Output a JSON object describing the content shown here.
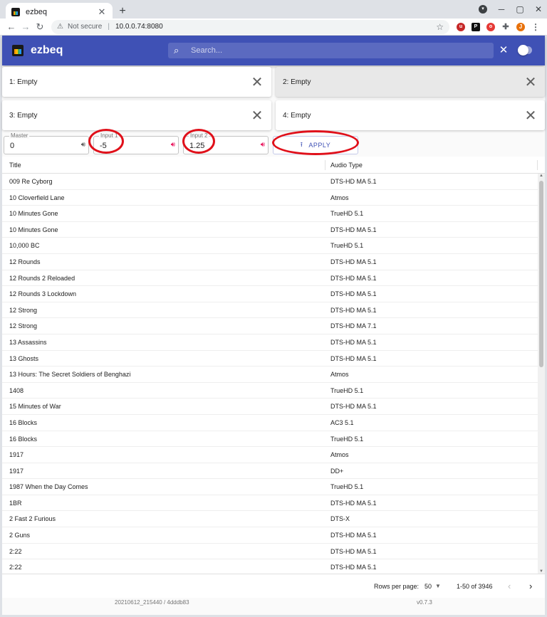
{
  "browser": {
    "tab_title": "ezbeq",
    "tab_close": "✕",
    "new_tab": "+",
    "security_label": "Not secure",
    "url": "10.0.0.74:8080",
    "profile_initial": "J"
  },
  "app": {
    "title": "ezbeq",
    "search": {
      "placeholder": "Search..."
    },
    "clear": "✕"
  },
  "slots": [
    {
      "label": "1: Empty",
      "active": false
    },
    {
      "label": "2: Empty",
      "active": true
    },
    {
      "label": "3: Empty",
      "active": false
    },
    {
      "label": "4: Empty",
      "active": false
    }
  ],
  "controls": {
    "master": {
      "label": "Master",
      "value": "0"
    },
    "input1": {
      "label": "Input 1",
      "value": "-5"
    },
    "input2": {
      "label": "Input 2",
      "value": "1.25"
    },
    "apply_label": "APPLY"
  },
  "table": {
    "headers": {
      "title": "Title",
      "audio": "Audio Type"
    },
    "rows": [
      {
        "title": "009 Re Cyborg",
        "audio": "DTS-HD MA 5.1"
      },
      {
        "title": "10 Cloverfield Lane",
        "audio": "Atmos"
      },
      {
        "title": "10 Minutes Gone",
        "audio": "TrueHD 5.1"
      },
      {
        "title": "10 Minutes Gone",
        "audio": "DTS-HD MA 5.1"
      },
      {
        "title": "10,000 BC",
        "audio": "TrueHD 5.1"
      },
      {
        "title": "12 Rounds",
        "audio": "DTS-HD MA 5.1"
      },
      {
        "title": "12 Rounds 2 Reloaded",
        "audio": "DTS-HD MA 5.1"
      },
      {
        "title": "12 Rounds 3 Lockdown",
        "audio": "DTS-HD MA 5.1"
      },
      {
        "title": "12 Strong",
        "audio": "DTS-HD MA 5.1"
      },
      {
        "title": "12 Strong",
        "audio": "DTS-HD MA 7.1"
      },
      {
        "title": "13 Assassins",
        "audio": "DTS-HD MA 5.1"
      },
      {
        "title": "13 Ghosts",
        "audio": "DTS-HD MA 5.1"
      },
      {
        "title": "13 Hours: The Secret Soldiers of Benghazi",
        "audio": "Atmos"
      },
      {
        "title": "1408",
        "audio": "TrueHD 5.1"
      },
      {
        "title": "15 Minutes of War",
        "audio": "DTS-HD MA 5.1"
      },
      {
        "title": "16 Blocks",
        "audio": "AC3 5.1"
      },
      {
        "title": "16 Blocks",
        "audio": "TrueHD 5.1"
      },
      {
        "title": "1917",
        "audio": "Atmos"
      },
      {
        "title": "1917",
        "audio": "DD+"
      },
      {
        "title": "1987 When the Day Comes",
        "audio": "TrueHD 5.1"
      },
      {
        "title": "1BR",
        "audio": "DTS-HD MA 5.1"
      },
      {
        "title": "2 Fast 2 Furious",
        "audio": "DTS-X"
      },
      {
        "title": "2 Guns",
        "audio": "DTS-HD MA 5.1"
      },
      {
        "title": "2:22",
        "audio": "DTS-HD MA 5.1"
      },
      {
        "title": "2:22",
        "audio": "DTS-HD MA 5.1"
      }
    ]
  },
  "pagination": {
    "rows_per_page_label": "Rows per page:",
    "rows_per_page": "50",
    "range": "1-50 of 3946"
  },
  "footer": {
    "build": "20210612_215440 / 4dddb83",
    "version": "v0.7.3"
  },
  "colors": {
    "appbar": "#3f51b5",
    "accent": "#e91e63",
    "annotation": "#e0101a"
  }
}
